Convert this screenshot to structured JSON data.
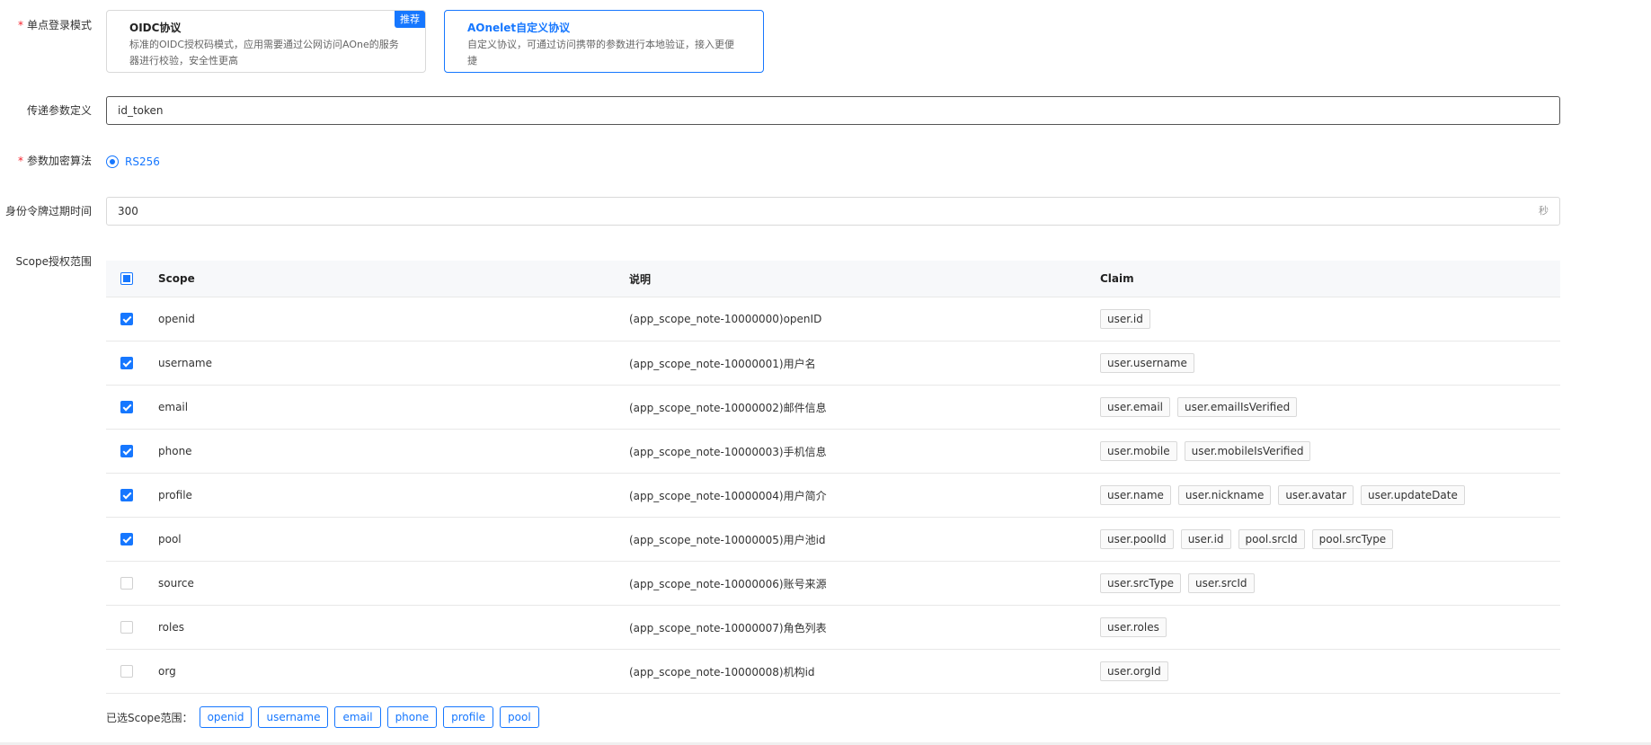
{
  "sso_mode": {
    "label": "单点登录模式",
    "options": [
      {
        "title": "OIDC协议",
        "desc": "标准的OIDC授权码模式，应用需要通过公网访问AOne的服务器进行校验，安全性更高",
        "badge": "推荐"
      },
      {
        "title": "AOnelet自定义协议",
        "desc": "自定义协议，可通过访问携带的参数进行本地验证，接入更便捷"
      }
    ]
  },
  "param_def": {
    "label": "传递参数定义",
    "value": "id_token"
  },
  "algorithm": {
    "label": "参数加密算法",
    "option": "RS256"
  },
  "token_expire": {
    "label": "身份令牌过期时间",
    "value": "300",
    "suffix": "秒"
  },
  "scope": {
    "label": "Scope授权范围",
    "columns": {
      "scope": "Scope",
      "note": "说明",
      "claim": "Claim"
    },
    "rows": [
      {
        "scope": "openid",
        "note": "(app_scope_note-10000000)openID",
        "claims": [
          "user.id"
        ],
        "checked": true
      },
      {
        "scope": "username",
        "note": "(app_scope_note-10000001)用户名",
        "claims": [
          "user.username"
        ],
        "checked": true
      },
      {
        "scope": "email",
        "note": "(app_scope_note-10000002)邮件信息",
        "claims": [
          "user.email",
          "user.emailIsVerified"
        ],
        "checked": true
      },
      {
        "scope": "phone",
        "note": "(app_scope_note-10000003)手机信息",
        "claims": [
          "user.mobile",
          "user.mobileIsVerified"
        ],
        "checked": true
      },
      {
        "scope": "profile",
        "note": "(app_scope_note-10000004)用户简介",
        "claims": [
          "user.name",
          "user.nickname",
          "user.avatar",
          "user.updateDate"
        ],
        "checked": true
      },
      {
        "scope": "pool",
        "note": "(app_scope_note-10000005)用户池id",
        "claims": [
          "user.poolId",
          "user.id",
          "pool.srcId",
          "pool.srcType"
        ],
        "checked": true
      },
      {
        "scope": "source",
        "note": "(app_scope_note-10000006)账号来源",
        "claims": [
          "user.srcType",
          "user.srcId"
        ],
        "checked": false
      },
      {
        "scope": "roles",
        "note": "(app_scope_note-10000007)角色列表",
        "claims": [
          "user.roles"
        ],
        "checked": false
      },
      {
        "scope": "org",
        "note": "(app_scope_note-10000008)机构id",
        "claims": [
          "user.orgId"
        ],
        "checked": false
      }
    ],
    "selected_label": "已选Scope范围：",
    "selected": [
      "openid",
      "username",
      "email",
      "phone",
      "profile",
      "pool"
    ]
  },
  "colors": {
    "primary": "#1677ff",
    "required": "#f5222d"
  }
}
